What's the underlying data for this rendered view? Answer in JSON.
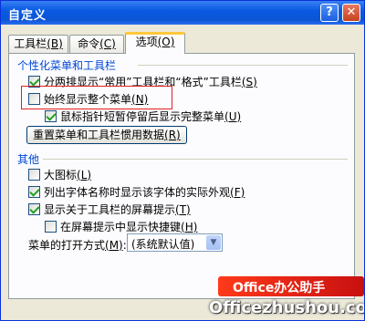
{
  "window": {
    "title": "自定义",
    "help_glyph": "?",
    "close_glyph": "✕"
  },
  "tabs": [
    {
      "label": "工具栏",
      "key": "(B)"
    },
    {
      "label": "命令",
      "key": "(C)"
    },
    {
      "label": "选项",
      "key": "(O)",
      "active": true
    }
  ],
  "group_personal": {
    "label": "个性化菜单和工具栏",
    "options": [
      {
        "text": "分两排显示“常用”工具栏和“格式”工具栏",
        "key": "(S)",
        "checked": true
      },
      {
        "text": "始终显示整个菜单",
        "key": "(N)",
        "checked": false
      },
      {
        "text": "鼠标指针短暂停留后显示完整菜单",
        "key": "(U)",
        "checked": true
      }
    ],
    "reset_button": {
      "text": "重置菜单和工具栏惯用数据",
      "key": "(R)"
    }
  },
  "group_other": {
    "label": "其他",
    "options": [
      {
        "text": "大图标",
        "key": "(L)",
        "checked": false
      },
      {
        "text": "列出字体名称时显示该字体的实际外观",
        "key": "(F)",
        "checked": true
      },
      {
        "text": "显示关于工具栏的屏幕提示",
        "key": "(T)",
        "checked": true
      },
      {
        "text": "在屏幕提示中显示快捷键",
        "key": "(H)",
        "checked": false
      }
    ],
    "animation": {
      "label": "菜单的打开方式",
      "key": "(M)",
      "value": "(系统默认值)"
    }
  },
  "watermark": {
    "logo": "Office办公助手",
    "url": "Officezhushou.com"
  },
  "colors": {
    "titlebar": "#0a5ae3",
    "group_label": "#0046d5",
    "highlight": "#e02020",
    "check": "#21a121"
  }
}
